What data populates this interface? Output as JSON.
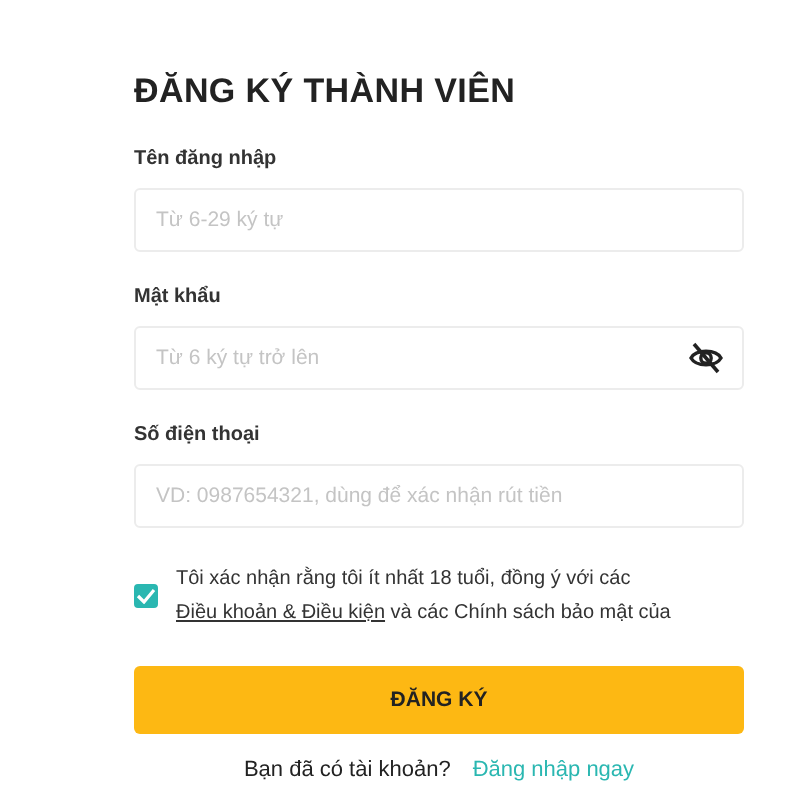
{
  "title": "ĐĂNG KÝ THÀNH VIÊN",
  "fields": [
    {
      "label": "Tên đăng nhập",
      "placeholder": "Từ 6-29 ký tự",
      "kind": "text"
    },
    {
      "label": "Mật khẩu",
      "placeholder": "Từ 6 ký tự trở lên",
      "kind": "password"
    },
    {
      "label": "Số điện thoại",
      "placeholder": "VD: 0987654321, dùng để xác nhận rút tiền",
      "kind": "text"
    }
  ],
  "agreement": {
    "checked": true,
    "text_before": "Tôi xác nhận rằng tôi ít nhất 18 tuổi, đồng ý với các",
    "link": "Điều khoản & Điều kiện",
    "text_after": "và các Chính sách bảo mật của"
  },
  "submit": "ĐĂNG KÝ",
  "login_prompt": {
    "text": "Bạn đã có tài khoản?",
    "link": "Đăng nhập ngay"
  }
}
